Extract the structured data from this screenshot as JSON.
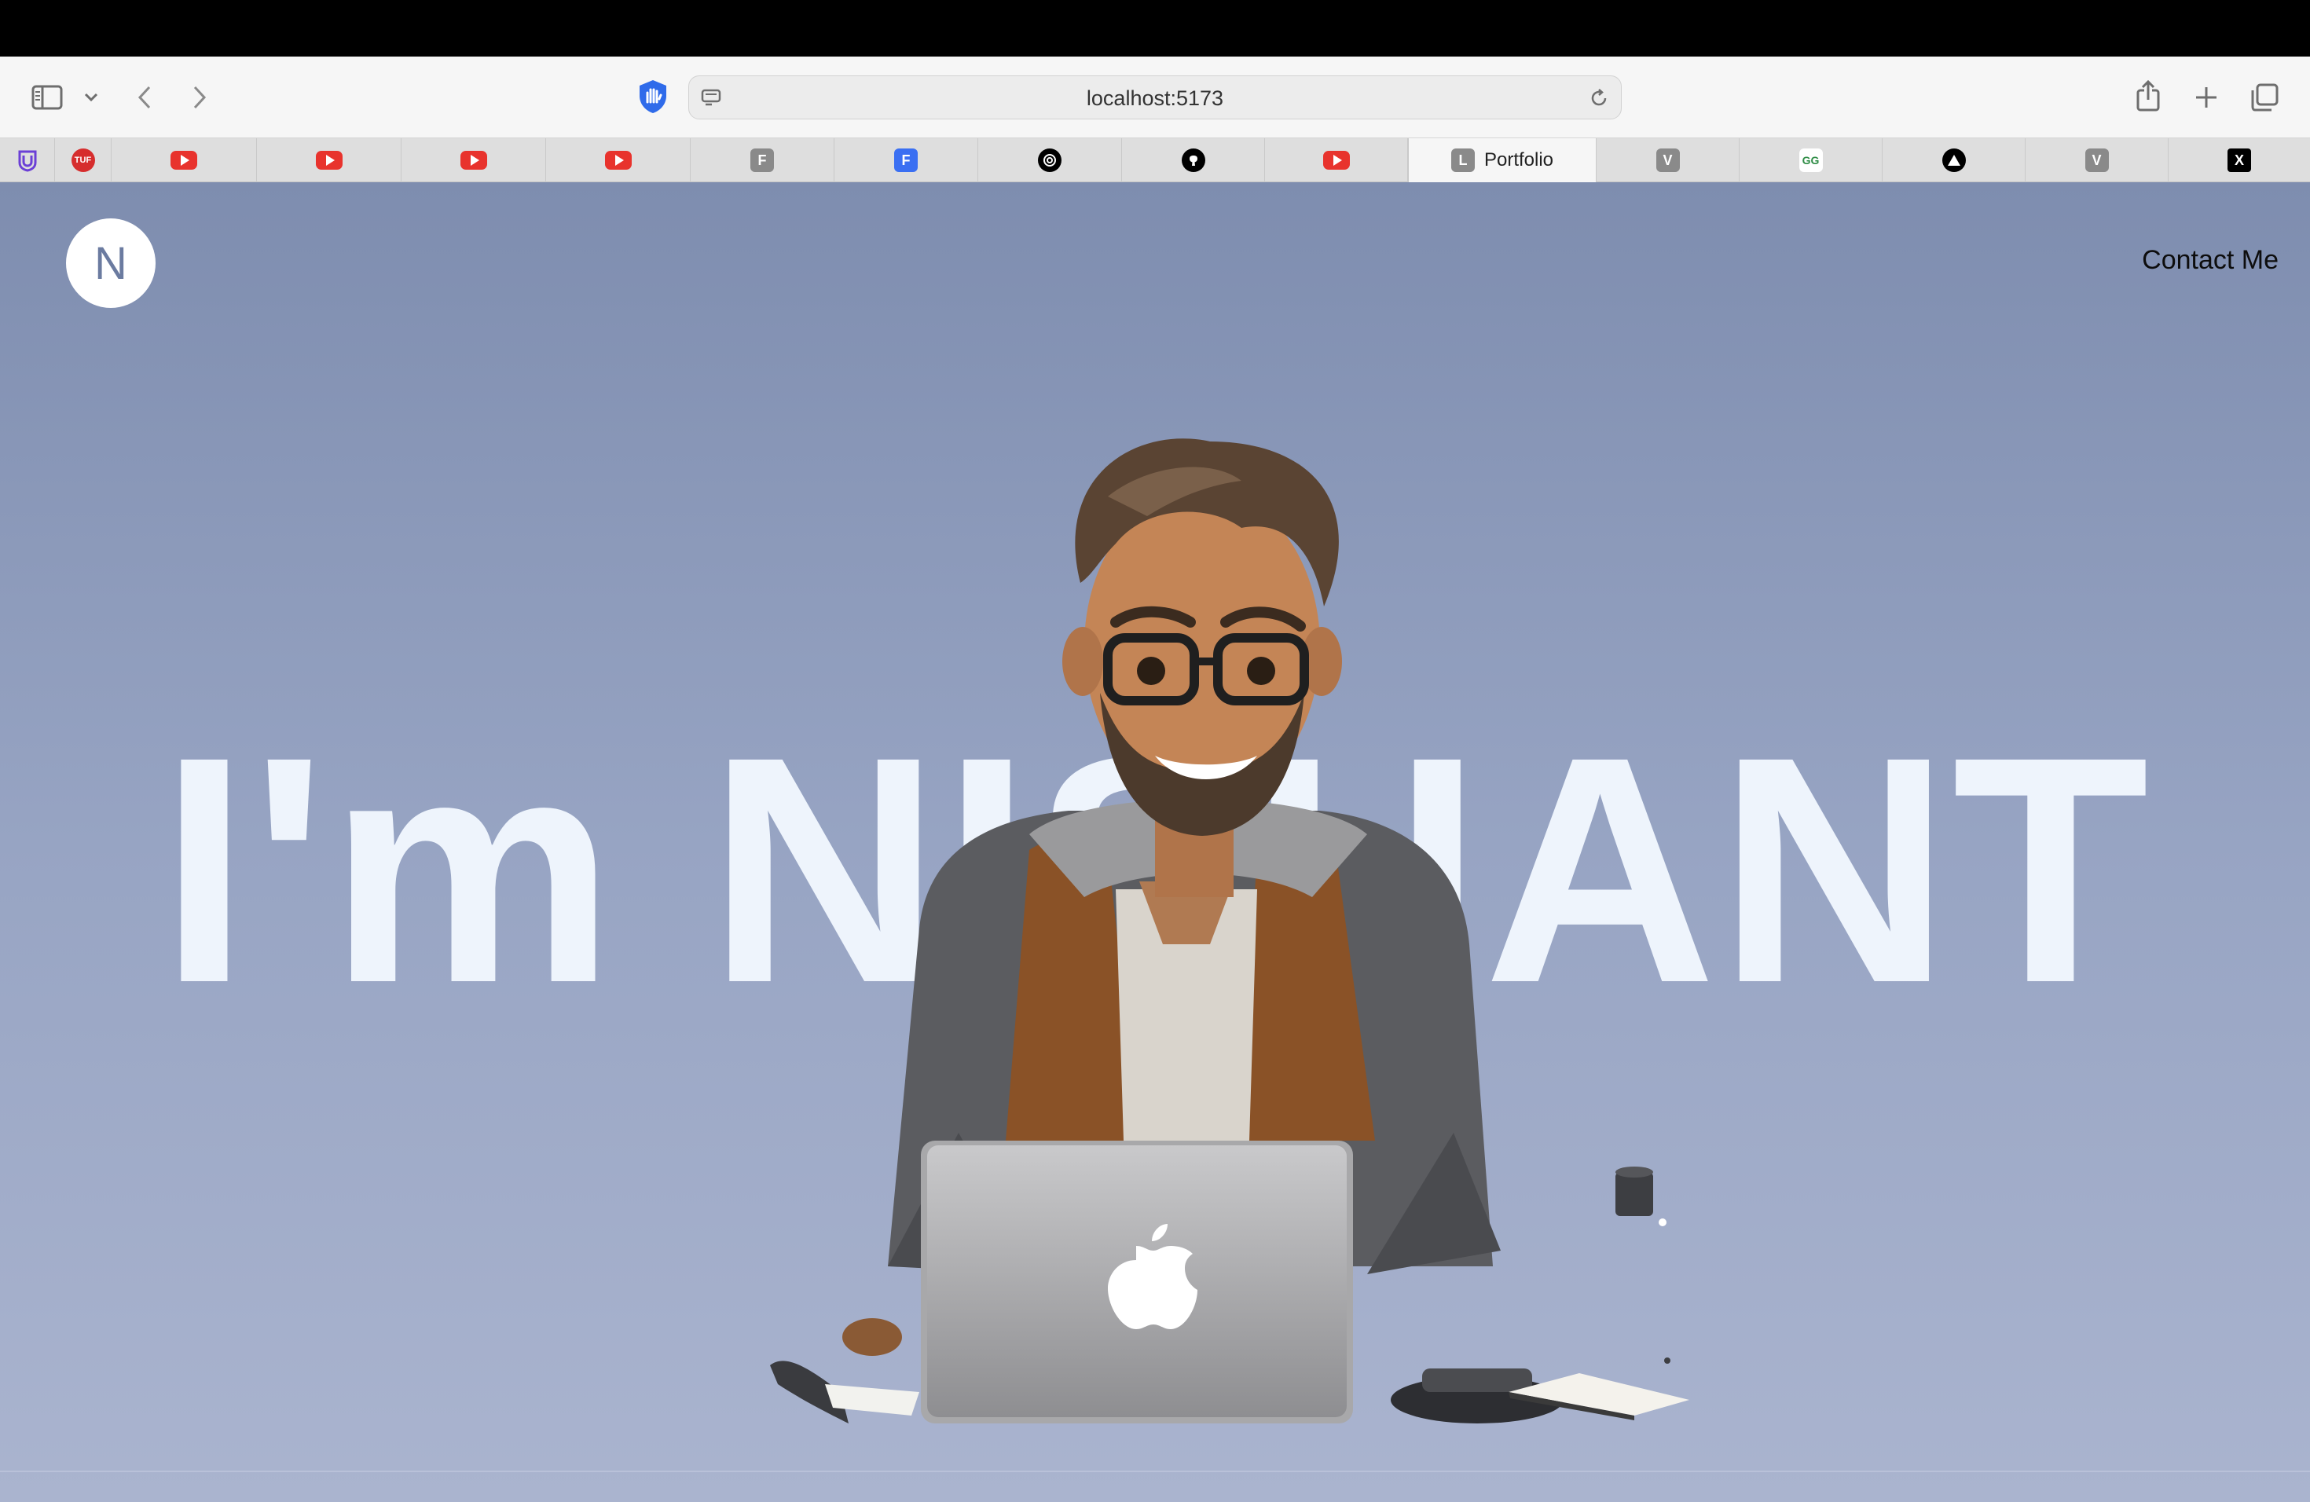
{
  "browser": {
    "url": "localhost:5173",
    "tabs": [
      {
        "icon": "extension-icon"
      },
      {
        "icon": "tuf-icon",
        "badge": "TUF"
      },
      {
        "icon": "youtube-icon"
      },
      {
        "icon": "youtube-icon"
      },
      {
        "icon": "youtube-icon"
      },
      {
        "icon": "youtube-icon"
      },
      {
        "icon": "f-grey-icon",
        "letter": "F"
      },
      {
        "icon": "f-blue-icon",
        "letter": "F"
      },
      {
        "icon": "openai-icon"
      },
      {
        "icon": "github-icon"
      },
      {
        "icon": "youtube-icon"
      },
      {
        "icon": "l-grey-icon",
        "letter": "L",
        "title": "Portfolio",
        "active": true
      },
      {
        "icon": "v-grey-icon",
        "letter": "V"
      },
      {
        "icon": "geeksforgeeks-icon",
        "letter": "GG"
      },
      {
        "icon": "triangle-icon"
      },
      {
        "icon": "v-grey-icon",
        "letter": "V"
      },
      {
        "icon": "x-icon",
        "letter": "X"
      }
    ]
  },
  "page": {
    "logo_letter": "N",
    "nav_contact": "Contact Me",
    "hero_text": "I'm NISHANT"
  },
  "colors": {
    "bg_top": "#7e8daf",
    "bg_bottom": "#aab4cf",
    "hero_text": "#eef4fc",
    "accent_blue": "#3a6ff2",
    "youtube_red": "#e8332d"
  }
}
